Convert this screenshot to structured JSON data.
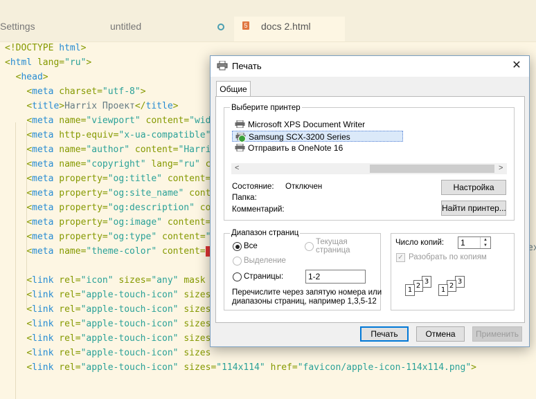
{
  "editor": {
    "tabs": [
      {
        "label": "Settings"
      },
      {
        "label": "untitled"
      },
      {
        "label": "docs 2.html"
      }
    ],
    "active_tab_icon": "html5-icon",
    "lines": [
      {
        "parts": [
          [
            "punct",
            "<!"
          ],
          [
            "kw",
            "DOCTYPE"
          ],
          [
            "txt",
            " "
          ],
          [
            "tag",
            "html"
          ],
          [
            "punct",
            ">"
          ]
        ]
      },
      {
        "parts": [
          [
            "punct",
            "<"
          ],
          [
            "tag",
            "html"
          ],
          [
            "txt",
            " "
          ],
          [
            "attr",
            "lang"
          ],
          [
            "punct",
            "="
          ],
          [
            "str",
            "\"ru\""
          ],
          [
            "punct",
            ">"
          ]
        ]
      },
      {
        "parts": [
          [
            "txt",
            "  "
          ],
          [
            "punct",
            "<"
          ],
          [
            "tag",
            "head"
          ],
          [
            "punct",
            ">"
          ]
        ]
      },
      {
        "parts": [
          [
            "txt",
            "    "
          ],
          [
            "punct",
            "<"
          ],
          [
            "tag",
            "meta"
          ],
          [
            "txt",
            " "
          ],
          [
            "attr",
            "charset"
          ],
          [
            "punct",
            "="
          ],
          [
            "str",
            "\"utf-8\""
          ],
          [
            "punct",
            ">"
          ]
        ]
      },
      {
        "parts": [
          [
            "txt",
            "    "
          ],
          [
            "punct",
            "<"
          ],
          [
            "tag",
            "title"
          ],
          [
            "punct",
            ">"
          ],
          [
            "txt",
            "Harrix Проект"
          ],
          [
            "punct",
            "</"
          ],
          [
            "tag",
            "title"
          ],
          [
            "punct",
            ">"
          ]
        ]
      },
      {
        "parts": [
          [
            "txt",
            "    "
          ],
          [
            "punct",
            "<"
          ],
          [
            "tag",
            "meta"
          ],
          [
            "txt",
            " "
          ],
          [
            "attr",
            "name"
          ],
          [
            "punct",
            "="
          ],
          [
            "str",
            "\"viewport\""
          ],
          [
            "txt",
            " "
          ],
          [
            "attr",
            "content"
          ],
          [
            "punct",
            "="
          ],
          [
            "str",
            "\"widt"
          ]
        ]
      },
      {
        "parts": [
          [
            "txt",
            "    "
          ],
          [
            "punct",
            "<"
          ],
          [
            "tag",
            "meta"
          ],
          [
            "txt",
            " "
          ],
          [
            "attr",
            "http-equiv"
          ],
          [
            "punct",
            "="
          ],
          [
            "str",
            "\"x-ua-compatible\""
          ]
        ]
      },
      {
        "parts": [
          [
            "txt",
            "    "
          ],
          [
            "punct",
            "<"
          ],
          [
            "tag",
            "meta"
          ],
          [
            "txt",
            " "
          ],
          [
            "attr",
            "name"
          ],
          [
            "punct",
            "="
          ],
          [
            "str",
            "\"author\""
          ],
          [
            "txt",
            " "
          ],
          [
            "attr",
            "content"
          ],
          [
            "punct",
            "="
          ],
          [
            "str",
            "\"Harrix"
          ]
        ]
      },
      {
        "parts": [
          [
            "txt",
            "    "
          ],
          [
            "punct",
            "<"
          ],
          [
            "tag",
            "meta"
          ],
          [
            "txt",
            " "
          ],
          [
            "attr",
            "name"
          ],
          [
            "punct",
            "="
          ],
          [
            "str",
            "\"copyright\""
          ],
          [
            "txt",
            " "
          ],
          [
            "attr",
            "lang"
          ],
          [
            "punct",
            "="
          ],
          [
            "str",
            "\"ru\""
          ],
          [
            "txt",
            " "
          ],
          [
            "attr",
            "co"
          ]
        ]
      },
      {
        "parts": [
          [
            "txt",
            "    "
          ],
          [
            "punct",
            "<"
          ],
          [
            "tag",
            "meta"
          ],
          [
            "txt",
            " "
          ],
          [
            "attr",
            "property"
          ],
          [
            "punct",
            "="
          ],
          [
            "str",
            "\"og:title\""
          ],
          [
            "txt",
            " "
          ],
          [
            "attr",
            "content"
          ],
          [
            "punct",
            "="
          ],
          [
            "str",
            "\"'"
          ]
        ]
      },
      {
        "parts": [
          [
            "txt",
            "    "
          ],
          [
            "punct",
            "<"
          ],
          [
            "tag",
            "meta"
          ],
          [
            "txt",
            " "
          ],
          [
            "attr",
            "property"
          ],
          [
            "punct",
            "="
          ],
          [
            "str",
            "\"og:site_name\""
          ],
          [
            "txt",
            " "
          ],
          [
            "attr",
            "conte"
          ]
        ]
      },
      {
        "parts": [
          [
            "txt",
            "    "
          ],
          [
            "punct",
            "<"
          ],
          [
            "tag",
            "meta"
          ],
          [
            "txt",
            " "
          ],
          [
            "attr",
            "property"
          ],
          [
            "punct",
            "="
          ],
          [
            "str",
            "\"og:description\""
          ],
          [
            "txt",
            " "
          ],
          [
            "attr",
            "cor"
          ]
        ]
      },
      {
        "parts": [
          [
            "txt",
            "    "
          ],
          [
            "punct",
            "<"
          ],
          [
            "tag",
            "meta"
          ],
          [
            "txt",
            " "
          ],
          [
            "attr",
            "property"
          ],
          [
            "punct",
            "="
          ],
          [
            "str",
            "\"og:image\""
          ],
          [
            "txt",
            " "
          ],
          [
            "attr",
            "content"
          ],
          [
            "punct",
            "="
          ],
          [
            "str",
            "\""
          ]
        ]
      },
      {
        "parts": [
          [
            "txt",
            "    "
          ],
          [
            "punct",
            "<"
          ],
          [
            "tag",
            "meta"
          ],
          [
            "txt",
            " "
          ],
          [
            "attr",
            "property"
          ],
          [
            "punct",
            "="
          ],
          [
            "str",
            "\"og:type\""
          ],
          [
            "txt",
            " "
          ],
          [
            "attr",
            "content"
          ],
          [
            "punct",
            "="
          ],
          [
            "str",
            "\"w"
          ]
        ]
      },
      {
        "parts": [
          [
            "txt",
            "    "
          ],
          [
            "punct",
            "<"
          ],
          [
            "tag",
            "meta"
          ],
          [
            "txt",
            " "
          ],
          [
            "attr",
            "name"
          ],
          [
            "punct",
            "="
          ],
          [
            "str",
            "\"theme-color\""
          ],
          [
            "txt",
            " "
          ],
          [
            "attr",
            "content"
          ],
          [
            "punct",
            "="
          ],
          [
            "swatch",
            ""
          ]
        ]
      },
      {
        "parts": [
          [
            "txt",
            ""
          ]
        ]
      },
      {
        "parts": [
          [
            "txt",
            "    "
          ],
          [
            "punct",
            "<"
          ],
          [
            "tag",
            "link"
          ],
          [
            "txt",
            " "
          ],
          [
            "attr",
            "rel"
          ],
          [
            "punct",
            "="
          ],
          [
            "str",
            "\"icon\""
          ],
          [
            "txt",
            " "
          ],
          [
            "attr",
            "sizes"
          ],
          [
            "punct",
            "="
          ],
          [
            "str",
            "\"any\""
          ],
          [
            "txt",
            " "
          ],
          [
            "attr",
            "mask"
          ],
          [
            "txt",
            " "
          ],
          [
            "attr",
            "h"
          ]
        ]
      },
      {
        "parts": [
          [
            "txt",
            "    "
          ],
          [
            "punct",
            "<"
          ],
          [
            "tag",
            "link"
          ],
          [
            "txt",
            " "
          ],
          [
            "attr",
            "rel"
          ],
          [
            "punct",
            "="
          ],
          [
            "str",
            "\"apple-touch-icon\""
          ],
          [
            "txt",
            " "
          ],
          [
            "attr",
            "sizes"
          ]
        ]
      },
      {
        "parts": [
          [
            "txt",
            "    "
          ],
          [
            "punct",
            "<"
          ],
          [
            "tag",
            "link"
          ],
          [
            "txt",
            " "
          ],
          [
            "attr",
            "rel"
          ],
          [
            "punct",
            "="
          ],
          [
            "str",
            "\"apple-touch-icon\""
          ],
          [
            "txt",
            " "
          ],
          [
            "attr",
            "sizes"
          ]
        ]
      },
      {
        "parts": [
          [
            "txt",
            "    "
          ],
          [
            "punct",
            "<"
          ],
          [
            "tag",
            "link"
          ],
          [
            "txt",
            " "
          ],
          [
            "attr",
            "rel"
          ],
          [
            "punct",
            "="
          ],
          [
            "str",
            "\"apple-touch-icon\""
          ],
          [
            "txt",
            " "
          ],
          [
            "attr",
            "sizes"
          ]
        ]
      },
      {
        "parts": [
          [
            "txt",
            "    "
          ],
          [
            "punct",
            "<"
          ],
          [
            "tag",
            "link"
          ],
          [
            "txt",
            " "
          ],
          [
            "attr",
            "rel"
          ],
          [
            "punct",
            "="
          ],
          [
            "str",
            "\"apple-touch-icon\""
          ],
          [
            "txt",
            " "
          ],
          [
            "attr",
            "sizes"
          ]
        ]
      },
      {
        "parts": [
          [
            "txt",
            "    "
          ],
          [
            "punct",
            "<"
          ],
          [
            "tag",
            "link"
          ],
          [
            "txt",
            " "
          ],
          [
            "attr",
            "rel"
          ],
          [
            "punct",
            "="
          ],
          [
            "str",
            "\"apple-touch-icon\""
          ],
          [
            "txt",
            " "
          ],
          [
            "attr",
            "sizes"
          ]
        ]
      },
      {
        "parts": [
          [
            "txt",
            "    "
          ],
          [
            "punct",
            "<"
          ],
          [
            "tag",
            "link"
          ],
          [
            "txt",
            " "
          ],
          [
            "attr",
            "rel"
          ],
          [
            "punct",
            "="
          ],
          [
            "str",
            "\"apple-touch-icon\""
          ],
          [
            "txt",
            " "
          ],
          [
            "attr",
            "sizes"
          ],
          [
            "punct",
            "="
          ],
          [
            "str",
            "\"114x114\""
          ],
          [
            "txt",
            " "
          ],
          [
            "attr",
            "href"
          ],
          [
            "punct",
            "="
          ],
          [
            "str",
            "\"favicon/apple-icon-114x114.png\""
          ],
          [
            "punct",
            ">"
          ]
        ]
      }
    ],
    "overflow_text": "ex"
  },
  "dialog": {
    "title": "Печать",
    "close_label": "✕",
    "tab_general": "Общие",
    "select_printer_label": "Выберите принтер",
    "printers": [
      {
        "name": "Microsoft XPS Document Writer",
        "selected": false
      },
      {
        "name": "Samsung SCX-3200 Series",
        "selected": true
      },
      {
        "name": "Отправить в OneNote 16",
        "selected": false
      }
    ],
    "status_label": "Состояние:",
    "status_value": "Отключен",
    "folder_label": "Папка:",
    "comment_label": "Комментарий:",
    "settings_button": "Настройка",
    "find_printer_button": "Найти принтер...",
    "page_range": {
      "title": "Диапазон страниц",
      "all": "Все",
      "current_page_line1": "Текущая",
      "current_page_line2": "страница",
      "selection": "Выделение",
      "pages": "Страницы:",
      "pages_value": "1-2",
      "hint_line1": "Перечислите через запятую номера или",
      "hint_line2": "диапазоны страниц, например 1,3,5-12"
    },
    "copies_label": "Число копий:",
    "copies_value": "1",
    "collate_label": "Разобрать по копиям",
    "collate_checked": true,
    "print_button": "Печать",
    "cancel_button": "Отмена",
    "apply_button": "Применить"
  }
}
